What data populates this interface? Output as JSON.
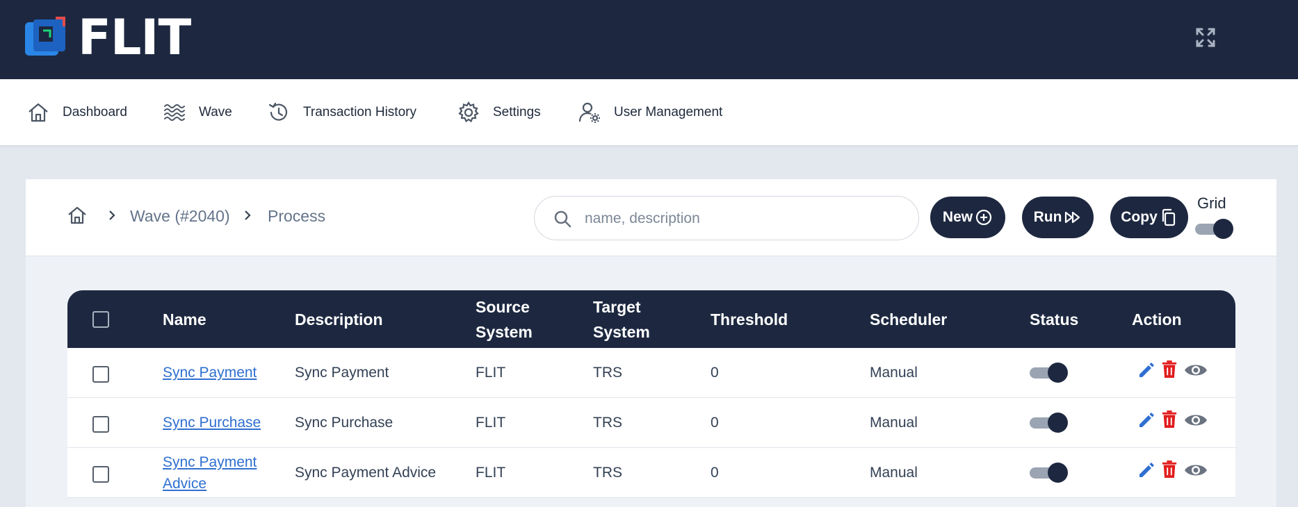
{
  "app": {
    "logo_text": "FLIT"
  },
  "nav": {
    "items": [
      {
        "label": "Dashboard",
        "icon": "home-icon"
      },
      {
        "label": "Wave",
        "icon": "waves-icon"
      },
      {
        "label": "Transaction History",
        "icon": "history-icon"
      },
      {
        "label": "Settings",
        "icon": "gear-icon"
      },
      {
        "label": "User Management",
        "icon": "user-gear-icon"
      }
    ]
  },
  "breadcrumb": {
    "items": [
      "Wave (#2040)",
      "Process"
    ]
  },
  "search": {
    "placeholder": "name, description",
    "value": ""
  },
  "toolbar": {
    "new_label": "New",
    "run_label": "Run",
    "copy_label": "Copy",
    "grid_label": "Grid",
    "grid_on": true
  },
  "table": {
    "columns": [
      "Name",
      "Description",
      "Source System",
      "Target System",
      "Threshold",
      "Scheduler",
      "Status",
      "Action"
    ],
    "rows": [
      {
        "name": "Sync Payment",
        "description": "Sync Payment",
        "source": "FLIT",
        "target": "TRS",
        "threshold": "0",
        "scheduler": "Manual",
        "status_on": true
      },
      {
        "name": "Sync Purchase",
        "description": "Sync Purchase",
        "source": "FLIT",
        "target": "TRS",
        "threshold": "0",
        "scheduler": "Manual",
        "status_on": true
      },
      {
        "name": "Sync Payment Advice",
        "description": "Sync Payment Advice",
        "source": "FLIT",
        "target": "TRS",
        "threshold": "0",
        "scheduler": "Manual",
        "status_on": true
      }
    ]
  },
  "colors": {
    "navy": "#1d2840",
    "link": "#2f6fd0",
    "edit": "#2f6fd0",
    "delete": "#e11d1d",
    "view": "#6b7280",
    "background": "#e3e8ef"
  }
}
